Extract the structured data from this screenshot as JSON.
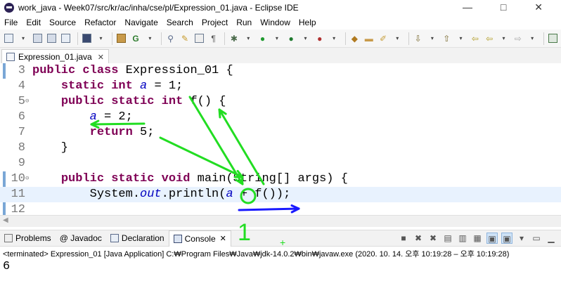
{
  "window": {
    "title": "work_java - Week07/src/kr/ac/inha/cse/pl/Expression_01.java - Eclipse IDE",
    "controls": "— □ ✕"
  },
  "menu": [
    "File",
    "Edit",
    "Source",
    "Refactor",
    "Navigate",
    "Search",
    "Project",
    "Run",
    "Window",
    "Help"
  ],
  "editor_tab": {
    "label": "Expression_01.java",
    "close": "✕"
  },
  "code_lines": [
    {
      "num": "3",
      "fold": "",
      "tokens": [
        {
          "t": "kw",
          "s": "public class"
        },
        {
          "t": "n",
          "s": " Expression_01 {"
        }
      ]
    },
    {
      "num": "4",
      "fold": "",
      "tokens": [
        {
          "t": "n",
          "s": "    "
        },
        {
          "t": "kw",
          "s": "static int"
        },
        {
          "t": "n",
          "s": " "
        },
        {
          "t": "fld",
          "s": "a"
        },
        {
          "t": "n",
          "s": " = 1;"
        }
      ]
    },
    {
      "num": "5",
      "fold": "⊖",
      "tokens": [
        {
          "t": "n",
          "s": "    "
        },
        {
          "t": "kw",
          "s": "public static int"
        },
        {
          "t": "n",
          "s": " f() {"
        }
      ]
    },
    {
      "num": "6",
      "fold": "",
      "tokens": [
        {
          "t": "n",
          "s": "        "
        },
        {
          "t": "fld",
          "s": "a"
        },
        {
          "t": "n",
          "s": " = 2;"
        }
      ]
    },
    {
      "num": "7",
      "fold": "",
      "tokens": [
        {
          "t": "n",
          "s": "        "
        },
        {
          "t": "kw",
          "s": "return"
        },
        {
          "t": "n",
          "s": " 5;"
        }
      ]
    },
    {
      "num": "8",
      "fold": "",
      "tokens": [
        {
          "t": "n",
          "s": "    }"
        }
      ]
    },
    {
      "num": "9",
      "fold": "",
      "tokens": []
    },
    {
      "num": "10",
      "fold": "⊖",
      "tokens": [
        {
          "t": "n",
          "s": "    "
        },
        {
          "t": "kw",
          "s": "public static void"
        },
        {
          "t": "n",
          "s": " main(String[] args) {"
        }
      ]
    },
    {
      "num": "11",
      "fold": "",
      "tokens": [
        {
          "t": "n",
          "s": "        System."
        },
        {
          "t": "fld",
          "s": "out"
        },
        {
          "t": "n",
          "s": ".println("
        },
        {
          "t": "fld",
          "s": "a"
        },
        {
          "t": "n",
          "s": " + f());"
        }
      ]
    },
    {
      "num": "12",
      "fold": "",
      "tokens": []
    }
  ],
  "current_line_index": 8,
  "console_tabs": [
    {
      "label": "Problems",
      "icon": "problems-icon"
    },
    {
      "label": "@ Javadoc",
      "icon": "javadoc-icon"
    },
    {
      "label": "Declaration",
      "icon": "declaration-icon"
    },
    {
      "label": "Console",
      "icon": "console-icon",
      "active": true
    }
  ],
  "console": {
    "terminated": "<terminated> Expression_01 [Java Application] C:₩Program Files₩Java₩jdk-14.0.2₩bin₩javaw.exe  (2020. 10. 14. 오후 10:19:28 – 오후 10:19:28)",
    "output": "6"
  },
  "annotations": {
    "number_label": "1",
    "plus_label": "+",
    "green": "#22dd22",
    "blue": "#1a1aff"
  }
}
